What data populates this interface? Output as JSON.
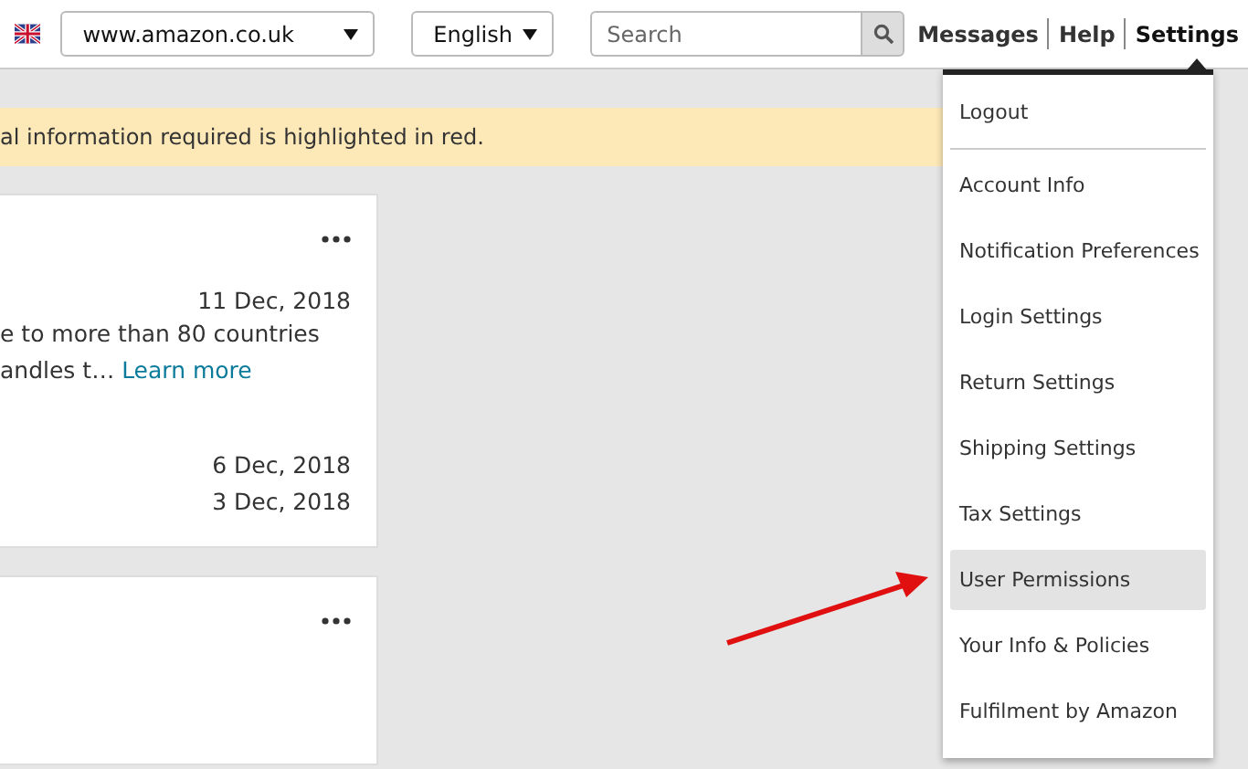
{
  "topbar": {
    "marketplace": "www.amazon.co.uk",
    "language": "English",
    "search": {
      "placeholder": "Search"
    },
    "nav": [
      {
        "label": "Messages",
        "selected": false
      },
      {
        "label": "Help",
        "selected": false
      },
      {
        "label": "Settings",
        "selected": true
      }
    ]
  },
  "settings_menu": {
    "logout": "Logout",
    "items": [
      {
        "label": "Account Info",
        "selected": false
      },
      {
        "label": "Notification Preferences",
        "selected": false
      },
      {
        "label": "Login Settings",
        "selected": false
      },
      {
        "label": "Return Settings",
        "selected": false
      },
      {
        "label": "Shipping Settings",
        "selected": false
      },
      {
        "label": "Tax Settings",
        "selected": false
      },
      {
        "label": "User Permissions",
        "selected": true
      },
      {
        "label": "Your Info & Policies",
        "selected": false
      },
      {
        "label": "Fulfilment by Amazon",
        "selected": false
      }
    ]
  },
  "banner": "al information required is highlighted in red.",
  "cards": [
    {
      "more_options": true,
      "date": "11 Dec, 2018",
      "lines": [
        "e to more than 80 countries",
        "andles t…"
      ],
      "link": "Learn more",
      "dates": [
        "6 Dec, 2018",
        "3 Dec, 2018"
      ]
    },
    {
      "more_options": true
    }
  ]
}
